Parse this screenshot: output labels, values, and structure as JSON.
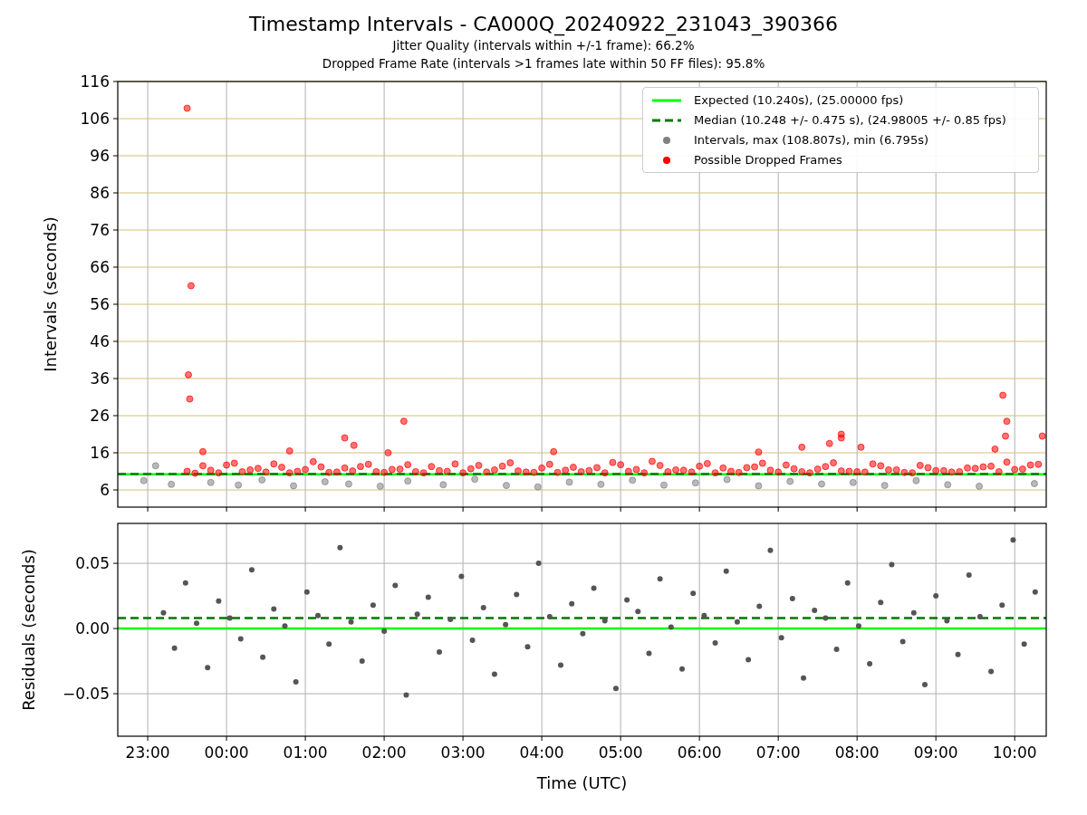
{
  "title": "Timestamp Intervals - CA000Q_20240922_231043_390366",
  "subtitles": [
    "Jitter Quality (intervals within +/-1 frame): 66.2%",
    "Dropped Frame Rate (intervals >1 frames late within 50 FF files): 95.8%"
  ],
  "plots": [
    {
      "chart_data": {
        "type": "scatter",
        "ylabel": "Intervals (seconds)",
        "grid": true,
        "xlim": [
          "2024-09-22T22:37:12",
          "2024-09-23T10:24:00"
        ],
        "ylim": [
          1.37,
          116
        ],
        "yticks": [
          {
            "value": 6,
            "label": "6"
          },
          {
            "value": 16,
            "label": "16"
          },
          {
            "value": 26,
            "label": "26"
          },
          {
            "value": 36,
            "label": "36"
          },
          {
            "value": 46,
            "label": "46"
          },
          {
            "value": 56,
            "label": "56"
          },
          {
            "value": 66,
            "label": "66"
          },
          {
            "value": 76,
            "label": "76"
          },
          {
            "value": 86,
            "label": "86"
          },
          {
            "value": 96,
            "label": "96"
          },
          {
            "value": 106,
            "label": "106"
          },
          {
            "value": 116,
            "label": "116"
          }
        ],
        "ref_lines": [
          {
            "axis": "y",
            "value": 10.24,
            "color": "#00ff00",
            "label": "Expected (10.240s), (25.00000 fps)"
          },
          {
            "axis": "y",
            "value": 10.248,
            "color": "#007a00",
            "label": "Median (10.248 +/- 0.475 s), (24.98005 +/- 0.85 fps)"
          }
        ],
        "series": [
          {
            "name": "Intervals, max (108.807s), min (6.795s)",
            "color": "#808080",
            "x": [
              "2024-09-22T22:57",
              "2024-09-22T23:06",
              "2024-09-22T23:18",
              "2024-09-22T23:48",
              "2024-09-23T00:09",
              "2024-09-23T00:27",
              "2024-09-23T00:51",
              "2024-09-23T01:15",
              "2024-09-23T01:33",
              "2024-09-23T01:57",
              "2024-09-23T02:18",
              "2024-09-23T02:45",
              "2024-09-23T03:09",
              "2024-09-23T03:33",
              "2024-09-23T03:57",
              "2024-09-23T04:21",
              "2024-09-23T04:45",
              "2024-09-23T05:09",
              "2024-09-23T05:33",
              "2024-09-23T05:57",
              "2024-09-23T06:21",
              "2024-09-23T06:45",
              "2024-09-23T07:09",
              "2024-09-23T07:33",
              "2024-09-23T07:57",
              "2024-09-23T08:21",
              "2024-09-23T08:45",
              "2024-09-23T09:09",
              "2024-09-23T09:33",
              "2024-09-23T10:15"
            ],
            "values": [
              8.5,
              12.5,
              7.5,
              8.0,
              7.3,
              8.7,
              7.1,
              8.2,
              7.6,
              7.0,
              8.4,
              7.4,
              8.9,
              7.2,
              6.8,
              8.1,
              7.5,
              8.6,
              7.3,
              7.9,
              8.8,
              7.1,
              8.3,
              7.6,
              8.0,
              7.2,
              8.5,
              7.4,
              7.0,
              7.7
            ]
          },
          {
            "name": "Possible Dropped Frames",
            "color": "#ff0000",
            "x": [
              "2024-09-22T23:30",
              "2024-09-22T23:42",
              "2024-09-22T23:54",
              "2024-09-23T00:06",
              "2024-09-23T00:18",
              "2024-09-23T00:30",
              "2024-09-23T00:42",
              "2024-09-23T00:54",
              "2024-09-23T01:06",
              "2024-09-23T01:18",
              "2024-09-23T01:30",
              "2024-09-23T01:42",
              "2024-09-23T01:54",
              "2024-09-23T02:06",
              "2024-09-23T02:18",
              "2024-09-23T02:30",
              "2024-09-23T02:42",
              "2024-09-23T02:54",
              "2024-09-23T03:06",
              "2024-09-23T03:18",
              "2024-09-23T03:30",
              "2024-09-23T03:42",
              "2024-09-23T03:54",
              "2024-09-23T04:06",
              "2024-09-23T04:18",
              "2024-09-23T04:30",
              "2024-09-23T04:42",
              "2024-09-23T04:54",
              "2024-09-23T05:06",
              "2024-09-23T05:18",
              "2024-09-23T05:30",
              "2024-09-23T05:42",
              "2024-09-23T05:54",
              "2024-09-23T06:06",
              "2024-09-23T06:18",
              "2024-09-23T06:30",
              "2024-09-23T06:42",
              "2024-09-23T06:54",
              "2024-09-23T07:06",
              "2024-09-23T07:18",
              "2024-09-23T07:30",
              "2024-09-23T07:42",
              "2024-09-23T07:54",
              "2024-09-23T08:06",
              "2024-09-23T08:18",
              "2024-09-23T08:30",
              "2024-09-23T08:42",
              "2024-09-23T08:54",
              "2024-09-23T09:06",
              "2024-09-23T09:18",
              "2024-09-23T09:30",
              "2024-09-23T09:42",
              "2024-09-23T09:54",
              "2024-09-23T10:06",
              "2024-09-23T10:18",
              "2024-09-22T23:36",
              "2024-09-22T23:48",
              "2024-09-23T00:00",
              "2024-09-23T00:12",
              "2024-09-23T00:24",
              "2024-09-23T00:36",
              "2024-09-23T00:48",
              "2024-09-23T01:00",
              "2024-09-23T01:12",
              "2024-09-23T01:24",
              "2024-09-23T01:36",
              "2024-09-23T01:48",
              "2024-09-23T02:00",
              "2024-09-23T02:12",
              "2024-09-23T02:24",
              "2024-09-23T02:36",
              "2024-09-23T02:48",
              "2024-09-23T03:00",
              "2024-09-23T03:12",
              "2024-09-23T03:24",
              "2024-09-23T03:36",
              "2024-09-23T03:48",
              "2024-09-23T04:00",
              "2024-09-23T04:12",
              "2024-09-23T04:24",
              "2024-09-23T04:36",
              "2024-09-23T04:48",
              "2024-09-23T05:00",
              "2024-09-23T05:12",
              "2024-09-23T05:24",
              "2024-09-23T05:36",
              "2024-09-23T05:48",
              "2024-09-23T06:00",
              "2024-09-23T06:12",
              "2024-09-23T06:24",
              "2024-09-23T06:36",
              "2024-09-23T06:48",
              "2024-09-23T07:00",
              "2024-09-23T07:12",
              "2024-09-23T07:24",
              "2024-09-23T07:36",
              "2024-09-23T07:48",
              "2024-09-23T08:00",
              "2024-09-23T08:12",
              "2024-09-23T08:24",
              "2024-09-23T08:36",
              "2024-09-23T08:48",
              "2024-09-23T09:00",
              "2024-09-23T09:12",
              "2024-09-23T09:24",
              "2024-09-23T09:36",
              "2024-09-23T09:48",
              "2024-09-23T10:00",
              "2024-09-23T10:12",
              "2024-09-22T23:30",
              "2024-09-22T23:33",
              "2024-09-22T23:31",
              "2024-09-22T23:32",
              "2024-09-23T02:15",
              "2024-09-23T07:48",
              "2024-09-23T07:48",
              "2024-09-23T09:51",
              "2024-09-23T09:54",
              "2024-09-23T09:53",
              "2024-09-23T10:21",
              "2024-09-23T01:30",
              "2024-09-23T01:37",
              "2024-09-23T07:39",
              "2024-09-23T08:03",
              "2024-09-23T07:18",
              "2024-09-23T06:45",
              "2024-09-23T04:09",
              "2024-09-23T00:48",
              "2024-09-22T23:42",
              "2024-09-23T02:03",
              "2024-09-23T09:45"
            ],
            "values": [
              11.0,
              12.5,
              10.6,
              13.2,
              11.4,
              10.8,
              12.1,
              11.0,
              13.6,
              10.7,
              11.9,
              12.3,
              10.9,
              11.5,
              12.8,
              10.6,
              11.2,
              13.0,
              11.7,
              10.8,
              12.4,
              11.1,
              10.7,
              12.9,
              11.3,
              10.9,
              12.0,
              13.4,
              11.0,
              10.6,
              12.6,
              11.4,
              10.8,
              13.1,
              11.9,
              10.7,
              12.2,
              11.3,
              12.7,
              10.9,
              11.6,
              13.3,
              11.0,
              10.8,
              12.5,
              11.4,
              10.6,
              12.0,
              11.2,
              10.9,
              11.8,
              12.4,
              13.5,
              11.6,
              12.9,
              10.5,
              11.3,
              12.7,
              10.9,
              11.8,
              13.0,
              10.6,
              11.5,
              12.2,
              10.8,
              11.1,
              12.9,
              10.7,
              11.6,
              10.9,
              12.3,
              11.0,
              10.6,
              12.6,
              11.4,
              13.3,
              10.8,
              11.9,
              10.7,
              12.1,
              11.2,
              10.6,
              12.8,
              11.5,
              13.7,
              10.9,
              11.3,
              12.4,
              10.6,
              11.0,
              12.0,
              13.2,
              10.8,
              11.7,
              10.6,
              12.3,
              11.1,
              10.9,
              13.0,
              11.4,
              10.7,
              12.6,
              11.2,
              10.8,
              11.9,
              12.2,
              10.9,
              11.5,
              12.7,
              108.8,
              61,
              37,
              30.5,
              24.5,
              21,
              20,
              31.5,
              24.5,
              20.5,
              20.5,
              20,
              18,
              18.5,
              17.5,
              17.5,
              16.2,
              16.3,
              16.5,
              16.3,
              16,
              17
            ]
          }
        ]
      }
    },
    {
      "chart_data": {
        "type": "scatter",
        "xlabel": "Time (UTC)",
        "ylabel": "Residuals (seconds)",
        "grid": true,
        "xlim": [
          "2024-09-22T22:37:12",
          "2024-09-23T10:24:00"
        ],
        "ylim": [
          -0.0826,
          0.0806
        ],
        "xticks": [
          {
            "value": "2024-09-22T23:00",
            "label": "23:00"
          },
          {
            "value": "2024-09-23T00:00",
            "label": "00:00"
          },
          {
            "value": "2024-09-23T01:00",
            "label": "01:00"
          },
          {
            "value": "2024-09-23T02:00",
            "label": "02:00"
          },
          {
            "value": "2024-09-23T03:00",
            "label": "03:00"
          },
          {
            "value": "2024-09-23T04:00",
            "label": "04:00"
          },
          {
            "value": "2024-09-23T05:00",
            "label": "05:00"
          },
          {
            "value": "2024-09-23T06:00",
            "label": "06:00"
          },
          {
            "value": "2024-09-23T07:00",
            "label": "07:00"
          },
          {
            "value": "2024-09-23T08:00",
            "label": "08:00"
          },
          {
            "value": "2024-09-23T09:00",
            "label": "09:00"
          },
          {
            "value": "2024-09-23T10:00",
            "label": "10:00"
          }
        ],
        "yticks": [
          {
            "value": -0.05,
            "label": "−0.05"
          },
          {
            "value": 0,
            "label": "0.00"
          },
          {
            "value": 0.05,
            "label": "0.05"
          }
        ],
        "ref_lines": [
          {
            "axis": "y",
            "value": 0,
            "color": "#00ff00"
          },
          {
            "axis": "y",
            "value": 0.008,
            "color": "#007a00"
          }
        ],
        "series": [
          {
            "color": "#555555",
            "x": [
              "2024-09-22T23:12:00",
              "2024-09-22T23:20:24",
              "2024-09-22T23:28:48",
              "2024-09-22T23:37:12",
              "2024-09-22T23:45:36",
              "2024-09-22T23:54:00",
              "2024-09-23T00:02:24",
              "2024-09-23T00:10:48",
              "2024-09-23T00:19:12",
              "2024-09-23T00:27:36",
              "2024-09-23T00:36:00",
              "2024-09-23T00:44:24",
              "2024-09-23T00:52:48",
              "2024-09-23T01:01:12",
              "2024-09-23T01:09:36",
              "2024-09-23T01:18:00",
              "2024-09-23T01:26:24",
              "2024-09-23T01:34:48",
              "2024-09-23T01:43:12",
              "2024-09-23T01:51:36",
              "2024-09-23T02:00:00",
              "2024-09-23T02:08:24",
              "2024-09-23T02:16:48",
              "2024-09-23T02:25:12",
              "2024-09-23T02:33:36",
              "2024-09-23T02:42:00",
              "2024-09-23T02:50:24",
              "2024-09-23T02:58:48",
              "2024-09-23T03:07:12",
              "2024-09-23T03:15:36",
              "2024-09-23T03:24:00",
              "2024-09-23T03:32:24",
              "2024-09-23T03:40:48",
              "2024-09-23T03:49:12",
              "2024-09-23T03:57:36",
              "2024-09-23T04:06:00",
              "2024-09-23T04:14:24",
              "2024-09-23T04:22:48",
              "2024-09-23T04:31:12",
              "2024-09-23T04:39:36",
              "2024-09-23T04:48:00",
              "2024-09-23T04:56:24",
              "2024-09-23T05:04:48",
              "2024-09-23T05:13:12",
              "2024-09-23T05:21:36",
              "2024-09-23T05:30:00",
              "2024-09-23T05:38:24",
              "2024-09-23T05:46:48",
              "2024-09-23T05:55:12",
              "2024-09-23T06:03:36",
              "2024-09-23T06:12:00",
              "2024-09-23T06:20:24",
              "2024-09-23T06:28:48",
              "2024-09-23T06:37:12",
              "2024-09-23T06:45:36",
              "2024-09-23T06:54:00",
              "2024-09-23T07:02:24",
              "2024-09-23T07:10:48",
              "2024-09-23T07:19:12",
              "2024-09-23T07:27:36",
              "2024-09-23T07:36:00",
              "2024-09-23T07:44:24",
              "2024-09-23T07:52:48",
              "2024-09-23T08:01:12",
              "2024-09-23T08:09:36",
              "2024-09-23T08:18:00",
              "2024-09-23T08:26:24",
              "2024-09-23T08:34:48",
              "2024-09-23T08:43:12",
              "2024-09-23T08:51:36",
              "2024-09-23T09:00:00",
              "2024-09-23T09:08:24",
              "2024-09-23T09:16:48",
              "2024-09-23T09:25:12",
              "2024-09-23T09:33:36",
              "2024-09-23T09:42:00",
              "2024-09-23T09:50:24",
              "2024-09-23T09:58:48",
              "2024-09-23T10:07:12",
              "2024-09-23T10:15:36"
            ],
            "values": [
              0.012,
              -0.015,
              0.035,
              0.004,
              -0.03,
              0.021,
              0.008,
              -0.008,
              0.045,
              -0.022,
              0.015,
              0.002,
              -0.041,
              0.028,
              0.01,
              -0.012,
              0.062,
              0.005,
              -0.025,
              0.018,
              -0.002,
              0.033,
              -0.051,
              0.011,
              0.024,
              -0.018,
              0.007,
              0.04,
              -0.009,
              0.016,
              -0.035,
              0.003,
              0.026,
              -0.014,
              0.05,
              0.009,
              -0.028,
              0.019,
              -0.004,
              0.031,
              0.006,
              -0.046,
              0.022,
              0.013,
              -0.019,
              0.038,
              0.001,
              -0.031,
              0.027,
              0.01,
              -0.011,
              0.044,
              0.005,
              -0.024,
              0.017,
              0.06,
              -0.007,
              0.023,
              -0.038,
              0.014,
              0.008,
              -0.016,
              0.035,
              0.002,
              -0.027,
              0.02,
              0.049,
              -0.01,
              0.012,
              -0.043,
              0.025,
              0.006,
              -0.02,
              0.041,
              0.009,
              -0.033,
              0.018,
              0.068,
              -0.012,
              0.028
            ]
          }
        ]
      }
    }
  ]
}
